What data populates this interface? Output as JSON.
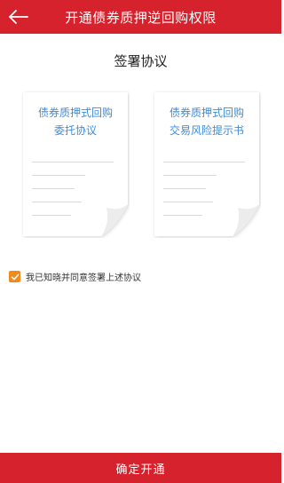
{
  "header": {
    "title": "开通债券质押逆回购权限",
    "back_icon": "arrow-left-icon"
  },
  "section_title": "签署协议",
  "documents": [
    {
      "title_line1": "债券质押式回购",
      "title_line2": "委托协议"
    },
    {
      "title_line1": "债券质押式回购",
      "title_line2": "交易风险提示书"
    }
  ],
  "agreement": {
    "checked": true,
    "label": "我已知晓并同意签署上述协议"
  },
  "footer": {
    "confirm_label": "确定开通"
  },
  "colors": {
    "brand_red": "#d6222c",
    "link_blue": "#3d8cd9",
    "checkbox_orange": "#f08a1c"
  }
}
